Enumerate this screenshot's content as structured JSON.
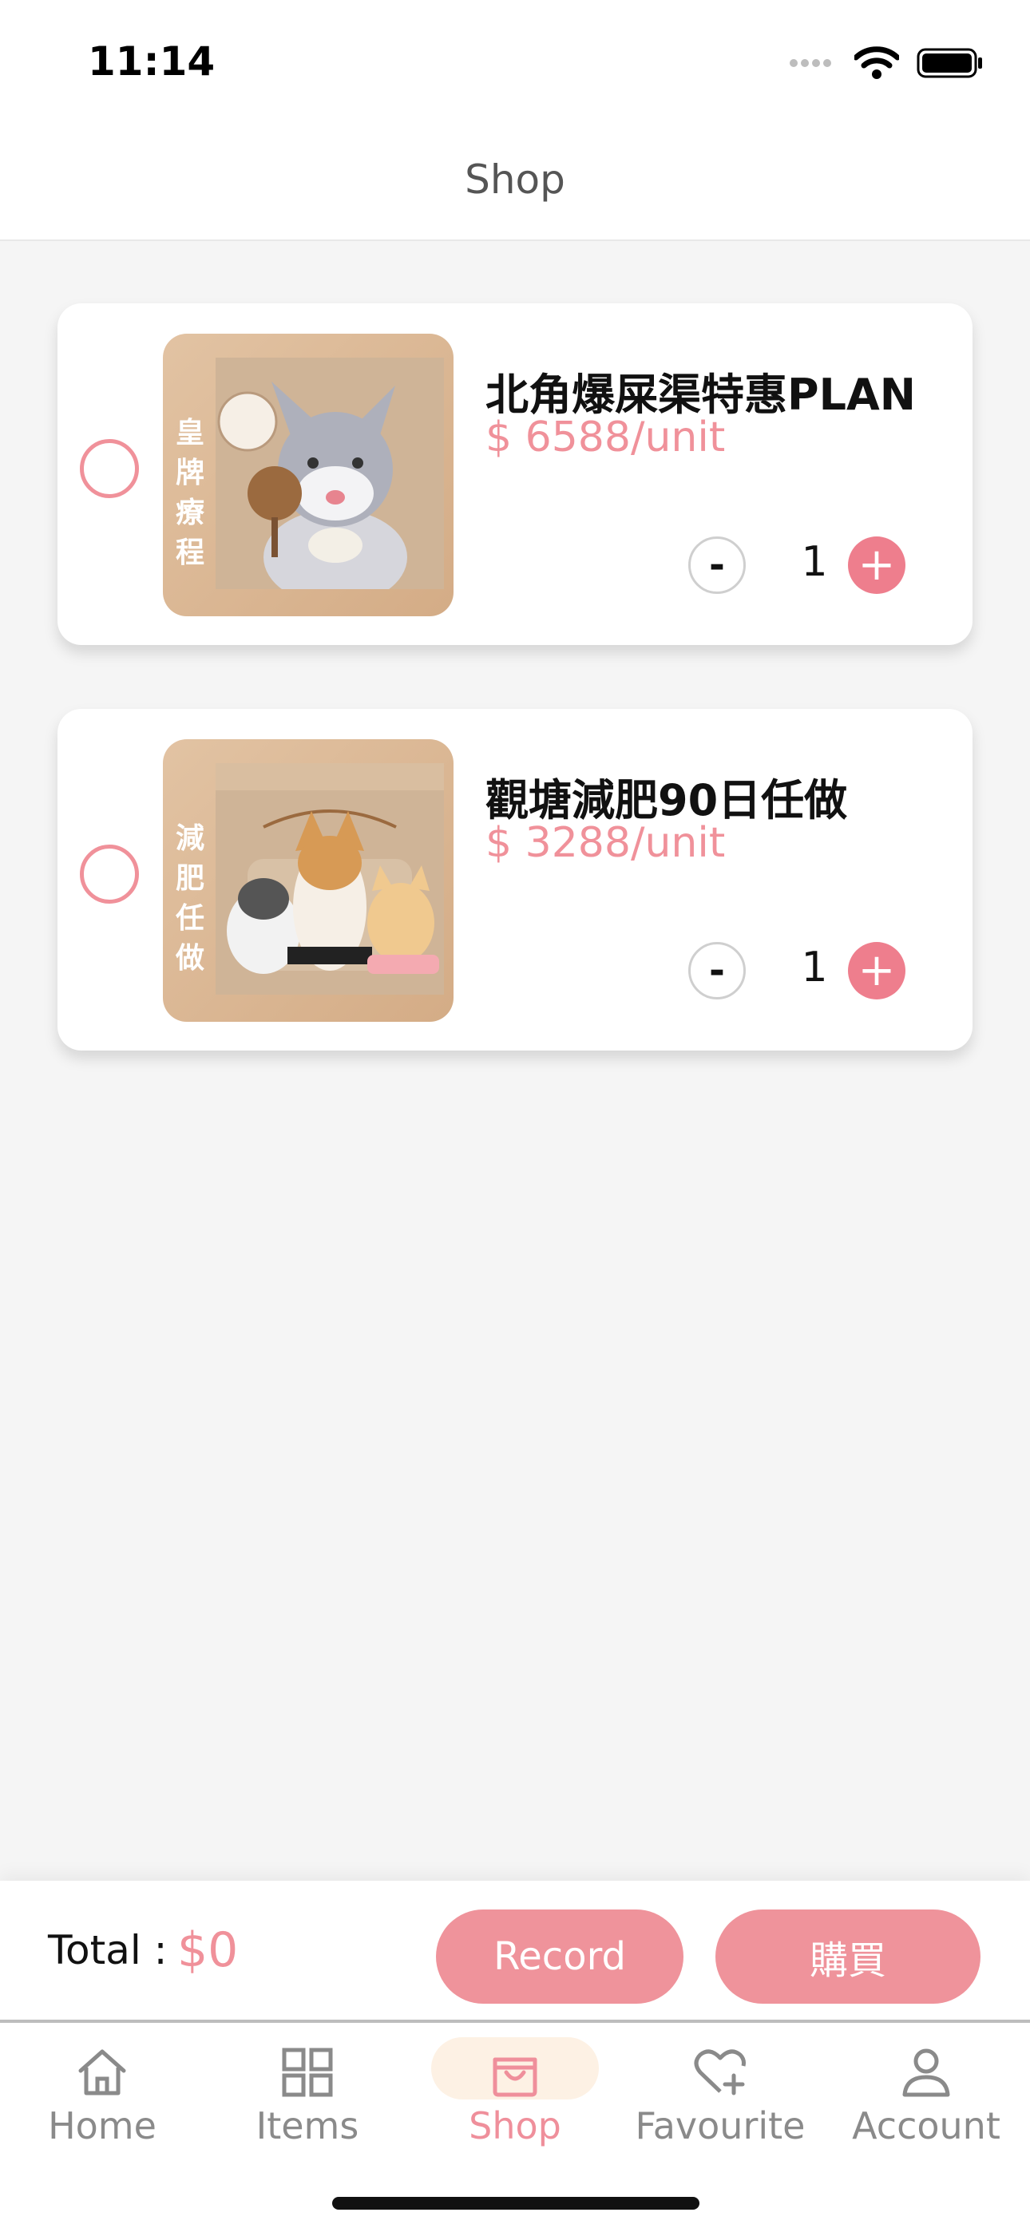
{
  "status_bar": {
    "time": "11:14"
  },
  "header": {
    "title": "Shop"
  },
  "cart": {
    "items": [
      {
        "name": "北角爆屎渠特惠PLAN",
        "price": "$ 6588/unit",
        "quantity": "1",
        "image_caption": "皇牌療程",
        "icon": "rabbit-illustration"
      },
      {
        "name": "觀塘減肥90日任做",
        "price": "$ 3288/unit",
        "quantity": "1",
        "image_caption": "減肥任做",
        "icon": "pets-illustration"
      }
    ],
    "minus_label": "-",
    "plus_label": "+"
  },
  "checkout": {
    "total_label": "Total :",
    "total_value": "$0",
    "record_label": "Record",
    "buy_label": "購買"
  },
  "tabbar": {
    "tabs": [
      {
        "label": "Home",
        "icon": "home-icon"
      },
      {
        "label": "Items",
        "icon": "grid-icon"
      },
      {
        "label": "Shop",
        "icon": "shopping-bag-icon"
      },
      {
        "label": "Favourite",
        "icon": "heart-plus-icon"
      },
      {
        "label": "Account",
        "icon": "person-icon"
      }
    ],
    "active": "Shop"
  },
  "colors": {
    "accent": "#ef939b",
    "price": "#f0919a",
    "active_pill": "#fdf1e4",
    "background": "#f5f5f5"
  }
}
